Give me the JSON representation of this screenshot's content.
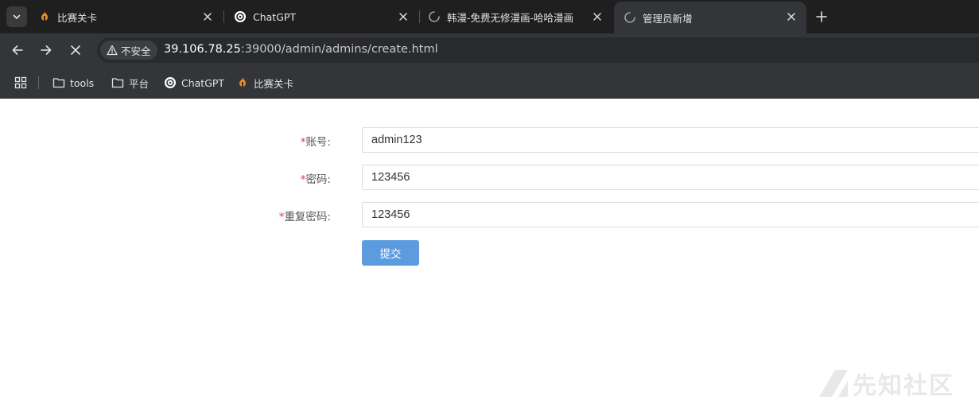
{
  "tabs": [
    {
      "title": "比赛关卡",
      "icon": "fire-logo-icon"
    },
    {
      "title": "ChatGPT",
      "icon": "openai-logo-icon"
    },
    {
      "title": "韩漫-免费无修漫画-哈哈漫画",
      "icon": "loading-spinner-icon"
    },
    {
      "title": "管理员新增",
      "icon": "loading-spinner-icon",
      "active": true
    }
  ],
  "toolbar": {
    "security_label": "不安全",
    "url_host": "39.106.78.25",
    "url_rest": ":39000/admin/admins/create.html"
  },
  "bookmarks": [
    {
      "label": "tools",
      "icon": "folder-icon"
    },
    {
      "label": "平台",
      "icon": "folder-icon"
    },
    {
      "label": "ChatGPT",
      "icon": "openai-logo-icon"
    },
    {
      "label": "比赛关卡",
      "icon": "fire-logo-icon"
    }
  ],
  "form": {
    "required_mark": "*",
    "account_label": "账号:",
    "account_value": "admin123",
    "password_label": "密码:",
    "password_value": "123456",
    "confirm_label": "重复密码:",
    "confirm_value": "123456",
    "submit_label": "提交"
  },
  "watermark": {
    "text": "先知社区"
  },
  "colors": {
    "tab_strip_bg": "#1f1f1f",
    "toolbar_bg": "#333538",
    "submit_bg": "#5b9bde",
    "required_red": "#e53935",
    "fire_orange": "#f08c1a"
  }
}
